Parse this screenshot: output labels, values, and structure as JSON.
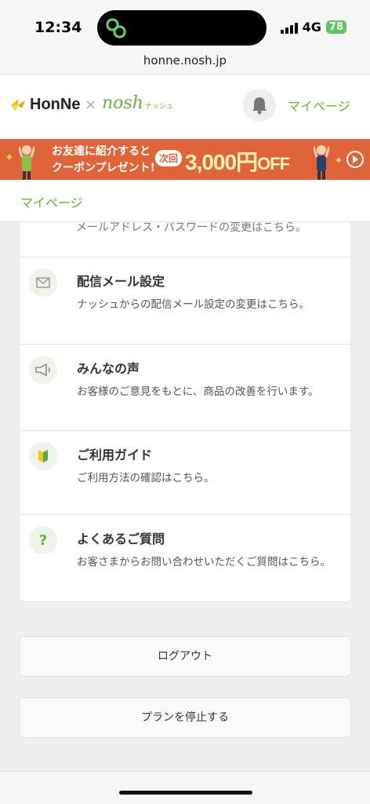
{
  "status_bar": {
    "time": "12:34",
    "network": "4G",
    "battery": "78"
  },
  "url": "honne.nosh.jp",
  "header": {
    "logo_honne": "HonNe",
    "logo_separator": "×",
    "logo_nosh": "nosh",
    "logo_nosh_sub": "ナッシュ",
    "mypage_link": "マイページ"
  },
  "banner": {
    "line1": "お友達に紹介すると",
    "line2": "クーポンプレゼント!",
    "next_label": "次回",
    "amount": "3,000円",
    "off": "OFF"
  },
  "breadcrumb": "マイページ",
  "cut_off_text": "メールアドレス・パスワードの変更はこちら。",
  "menu_items": [
    {
      "title": "配信メール設定",
      "description": "ナッシュからの配信メール設定の変更はこちら。",
      "icon": "envelope-icon"
    },
    {
      "title": "みんなの声",
      "description": "お客様のご意見をもとに、商品の改善を行います。",
      "icon": "megaphone-icon"
    },
    {
      "title": "ご利用ガイド",
      "description": "ご利用方法の確認はこちら。",
      "icon": "beginner-mark-icon"
    },
    {
      "title": "よくあるご質問",
      "description": "お客さまからお問い合わせいただくご質問はこちら。",
      "icon": "question-icon"
    }
  ],
  "buttons": {
    "logout": "ログアウト",
    "stop_plan": "プランを停止する"
  },
  "colors": {
    "accent_green": "#6aae3c",
    "banner_orange": "#e0643a"
  }
}
